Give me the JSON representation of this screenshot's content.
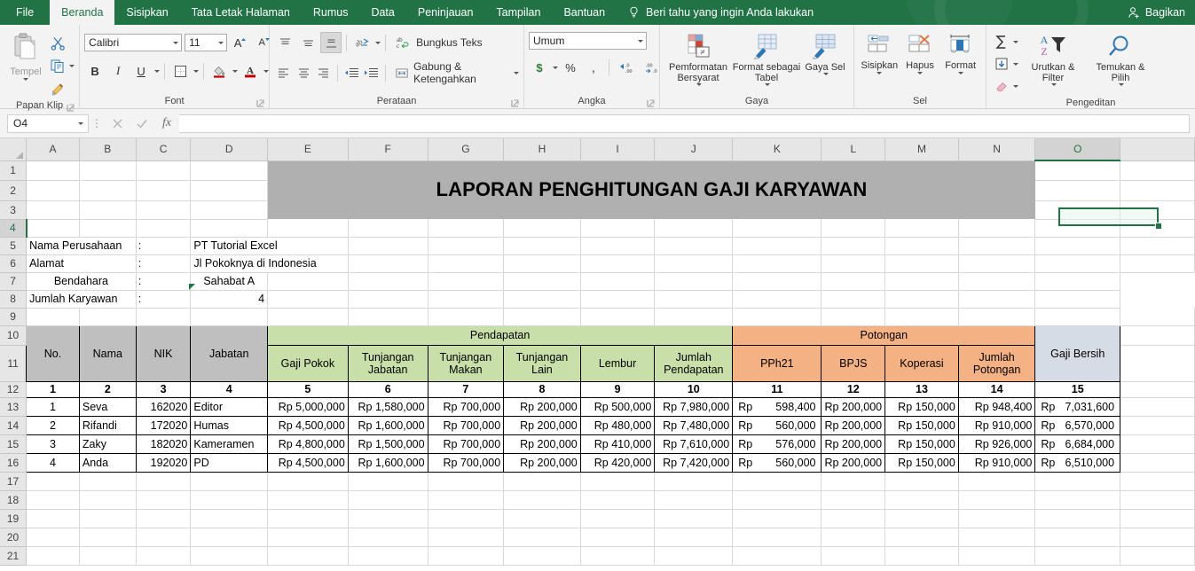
{
  "ribbon": {
    "tabs": [
      {
        "label": "File",
        "active": false,
        "file": true
      },
      {
        "label": "Beranda",
        "active": true
      },
      {
        "label": "Sisipkan",
        "active": false
      },
      {
        "label": "Tata Letak Halaman",
        "active": false
      },
      {
        "label": "Rumus",
        "active": false
      },
      {
        "label": "Data",
        "active": false
      },
      {
        "label": "Peninjauan",
        "active": false
      },
      {
        "label": "Tampilan",
        "active": false
      },
      {
        "label": "Bantuan",
        "active": false
      }
    ],
    "tell_me": "Beri tahu yang ingin Anda lakukan",
    "share_label": "Bagikan",
    "groups": {
      "clipboard": {
        "label": "Papan Klip",
        "paste": "Tempel",
        "cut_icon": "scissors-icon",
        "copy_icon": "copy-icon",
        "format_painter_icon": "format-painter-icon"
      },
      "font": {
        "label": "Font",
        "font_name": "Calibri",
        "font_size": "11",
        "grow_font": "A",
        "shrink_font": "A",
        "bold": "B",
        "italic": "I",
        "underline": "U",
        "borders_icon": "borders-icon",
        "fill_color_icon": "fill-color-icon",
        "font_color_icon": "font-color-icon"
      },
      "alignment": {
        "label": "Perataan",
        "wrap_text": "Bungkus Teks",
        "merge_center": "Gabung & Ketengahkan",
        "orientation_icon": "text-orientation-icon",
        "decrease_indent_icon": "decrease-indent-icon",
        "increase_indent_icon": "increase-indent-icon"
      },
      "number": {
        "label": "Angka",
        "format": "Umum",
        "currency": "$",
        "percent": "%",
        "comma": ",",
        "decrease_decimal_icon": "decrease-decimal-icon",
        "increase_decimal_icon": "increase-decimal-icon"
      },
      "styles": {
        "label": "Gaya",
        "conditional_formatting": "Pemformatan Bersyarat",
        "format_as_table": "Format sebagai Tabel",
        "cell_styles": "Gaya Sel"
      },
      "cells": {
        "label": "Sel",
        "insert": "Sisipkan",
        "delete": "Hapus",
        "format": "Format"
      },
      "editing": {
        "label": "Pengeditan",
        "autosum_icon": "sigma-icon",
        "fill_icon": "fill-down-icon",
        "clear_icon": "eraser-icon",
        "sort_filter": "Urutkan & Filter",
        "find_select": "Temukan & Pilih"
      }
    }
  },
  "formula_bar": {
    "name_box": "O4",
    "cancel_icon": "close-icon",
    "enter_icon": "check-icon",
    "function_icon": "fx-icon",
    "formula": ""
  },
  "grid": {
    "columns": [
      "A",
      "B",
      "C",
      "D",
      "E",
      "F",
      "G",
      "H",
      "I",
      "J",
      "K",
      "L",
      "M",
      "N",
      "O"
    ],
    "selected_column": "O",
    "selected_cell": "O4",
    "rows": [
      "1",
      "2",
      "3",
      "4",
      "5",
      "6",
      "7",
      "8",
      "9",
      "10",
      "11",
      "12",
      "13",
      "14",
      "15",
      "16",
      "17",
      "18",
      "19",
      "20",
      "21"
    ],
    "active_row": "4"
  },
  "sheet": {
    "title": "LAPORAN PENGHITUNGAN GAJI KARYAWAN",
    "info": [
      {
        "label": "Nama Perusahaan",
        "sep": ":",
        "value": "PT Tutorial Excel",
        "align": "left"
      },
      {
        "label": "Alamat",
        "sep": ":",
        "value": "Jl Pokoknya di Indonesia",
        "align": "left"
      },
      {
        "label": "Bendahara",
        "sep": ":",
        "value": "Sahabat A",
        "align": "center"
      },
      {
        "label": "Jumlah Karyawan",
        "sep": ":",
        "value": "4",
        "align": "right"
      }
    ],
    "group_headers": {
      "pendapatan": "Pendapatan",
      "potongan": "Potongan"
    },
    "headers": {
      "no": "No.",
      "nama": "Nama",
      "nik": "NIK",
      "jabatan": "Jabatan",
      "gaji_pokok": "Gaji Pokok",
      "tunjangan_jabatan": "Tunjangan Jabatan",
      "tunjangan_makan": "Tunjangan Makan",
      "tunjangan_lain": "Tunjangan Lain",
      "lembur": "Lembur",
      "jumlah_pendapatan": "Jumlah Pendapatan",
      "pph21": "PPh21",
      "bpjs": "BPJS",
      "koperasi": "Koperasi",
      "jumlah_potongan": "Jumlah Potongan",
      "gaji_bersih": "Gaji Bersih"
    },
    "column_numbers": [
      "1",
      "2",
      "3",
      "4",
      "5",
      "6",
      "7",
      "8",
      "9",
      "10",
      "11",
      "12",
      "13",
      "14",
      "15"
    ],
    "data_rows": [
      {
        "no": "1",
        "nama": "Seva",
        "nik": "162020",
        "jabatan": "Editor",
        "gaji_pokok": "Rp 5,000,000",
        "tunjangan_jabatan": "Rp 1,580,000",
        "tunjangan_makan": "Rp  700,000",
        "tunjangan_lain": "Rp  200,000",
        "lembur": "Rp  500,000",
        "jumlah_pendapatan": "Rp 7,980,000",
        "pph21_cur": "Rp",
        "pph21": "598,400",
        "bpjs": "Rp  200,000",
        "koperasi": "Rp  150,000",
        "jumlah_potongan": "Rp  948,400",
        "gaji_bersih_cur": "Rp",
        "gaji_bersih": "7,031,600"
      },
      {
        "no": "2",
        "nama": "Rifandi",
        "nik": "172020",
        "jabatan": "Humas",
        "gaji_pokok": "Rp 4,500,000",
        "tunjangan_jabatan": "Rp 1,600,000",
        "tunjangan_makan": "Rp  700,000",
        "tunjangan_lain": "Rp  200,000",
        "lembur": "Rp  480,000",
        "jumlah_pendapatan": "Rp 7,480,000",
        "pph21_cur": "Rp",
        "pph21": "560,000",
        "bpjs": "Rp  200,000",
        "koperasi": "Rp  150,000",
        "jumlah_potongan": "Rp  910,000",
        "gaji_bersih_cur": "Rp",
        "gaji_bersih": "6,570,000"
      },
      {
        "no": "3",
        "nama": "Zaky",
        "nik": "182020",
        "jabatan": "Kameramen",
        "gaji_pokok": "Rp 4,800,000",
        "tunjangan_jabatan": "Rp 1,500,000",
        "tunjangan_makan": "Rp  700,000",
        "tunjangan_lain": "Rp  200,000",
        "lembur": "Rp  410,000",
        "jumlah_pendapatan": "Rp 7,610,000",
        "pph21_cur": "Rp",
        "pph21": "576,000",
        "bpjs": "Rp  200,000",
        "koperasi": "Rp  150,000",
        "jumlah_potongan": "Rp  926,000",
        "gaji_bersih_cur": "Rp",
        "gaji_bersih": "6,684,000"
      },
      {
        "no": "4",
        "nama": "Anda",
        "nik": "192020",
        "jabatan": "PD",
        "gaji_pokok": "Rp 4,500,000",
        "tunjangan_jabatan": "Rp 1,600,000",
        "tunjangan_makan": "Rp  700,000",
        "tunjangan_lain": "Rp  200,000",
        "lembur": "Rp  420,000",
        "jumlah_pendapatan": "Rp 7,420,000",
        "pph21_cur": "Rp",
        "pph21": "560,000",
        "bpjs": "Rp  200,000",
        "koperasi": "Rp  150,000",
        "jumlah_potongan": "Rp  910,000",
        "gaji_bersih_cur": "Rp",
        "gaji_bersih": "6,510,000"
      }
    ]
  },
  "colors": {
    "ribbon_green": "#217346",
    "header_gray": "#bfbfbf",
    "income_green": "#c9dfa9",
    "deduction_orange": "#f4b183",
    "net_blue": "#d6dce5",
    "title_band": "#b0b0b0"
  }
}
